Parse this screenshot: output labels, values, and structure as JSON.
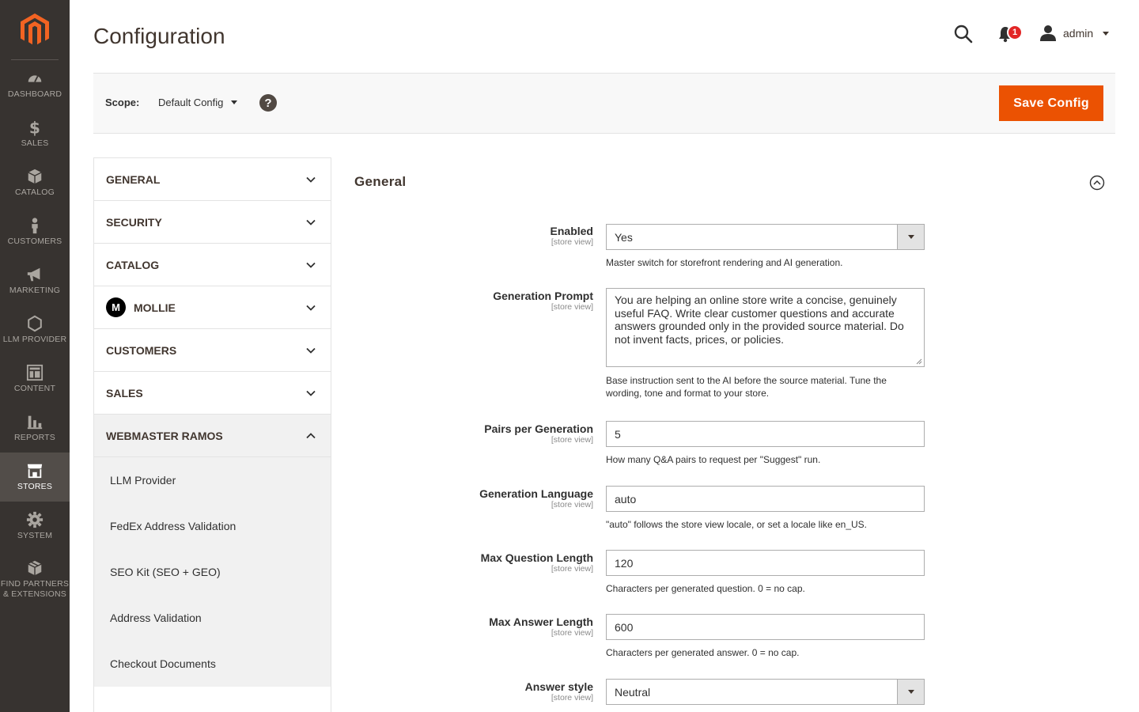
{
  "nav": {
    "items": [
      {
        "label": "DASHBOARD",
        "icon": "dashboard-icon"
      },
      {
        "label": "SALES",
        "icon": "dollar-icon"
      },
      {
        "label": "CATALOG",
        "icon": "box-icon"
      },
      {
        "label": "CUSTOMERS",
        "icon": "person-icon"
      },
      {
        "label": "MARKETING",
        "icon": "megaphone-icon"
      },
      {
        "label": "LLM PROVIDER",
        "icon": "hexagon-icon"
      },
      {
        "label": "CONTENT",
        "icon": "layout-icon"
      },
      {
        "label": "REPORTS",
        "icon": "bar-chart-icon"
      },
      {
        "label": "STORES",
        "icon": "store-icon",
        "active": true
      },
      {
        "label": "SYSTEM",
        "icon": "gear-icon"
      },
      {
        "label": "FIND PARTNERS & EXTENSIONS",
        "icon": "extensions-box-icon"
      }
    ]
  },
  "header": {
    "title": "Configuration",
    "notification_count": "1",
    "user": "admin"
  },
  "scope": {
    "label": "Scope:",
    "value": "Default Config",
    "help": "?",
    "save_label": "Save Config"
  },
  "tabs": [
    {
      "label": "GENERAL"
    },
    {
      "label": "SECURITY"
    },
    {
      "label": "CATALOG"
    },
    {
      "label": "MOLLIE",
      "logo": "m"
    },
    {
      "label": "CUSTOMERS"
    },
    {
      "label": "SALES"
    },
    {
      "label": "WEBMASTER RAMOS",
      "open": true
    }
  ],
  "subtabs": [
    "LLM Provider",
    "FedEx Address Validation",
    "SEO Kit (SEO + GEO)",
    "Address Validation",
    "Checkout Documents"
  ],
  "section": {
    "title": "General"
  },
  "fields": {
    "enabled": {
      "label": "Enabled",
      "scope": "[store view]",
      "value": "Yes",
      "note": "Master switch for storefront rendering and AI generation."
    },
    "prompt": {
      "label": "Generation Prompt",
      "scope": "[store view]",
      "value": "You are helping an online store write a concise, genuinely useful FAQ. Write clear customer questions and accurate answers grounded only in the provided source material. Do not invent facts, prices, or policies.",
      "note": "Base instruction sent to the AI before the source material. Tune the wording, tone and format to your store."
    },
    "pairs": {
      "label": "Pairs per Generation",
      "scope": "[store view]",
      "value": "5",
      "note": "How many Q&A pairs to request per \"Suggest\" run."
    },
    "language": {
      "label": "Generation Language",
      "scope": "[store view]",
      "value": "auto",
      "note": "\"auto\" follows the store view locale, or set a locale like en_US."
    },
    "max_q": {
      "label": "Max Question Length",
      "scope": "[store view]",
      "value": "120",
      "note": "Characters per generated question. 0 = no cap."
    },
    "max_a": {
      "label": "Max Answer Length",
      "scope": "[store view]",
      "value": "600",
      "note": "Characters per generated answer. 0 = no cap."
    },
    "style": {
      "label": "Answer style",
      "scope": "[store view]",
      "value": "Neutral"
    }
  },
  "colors": {
    "nav_bg": "#373330",
    "nav_active": "#524d49",
    "accent": "#eb5202",
    "badge": "#e22626"
  }
}
